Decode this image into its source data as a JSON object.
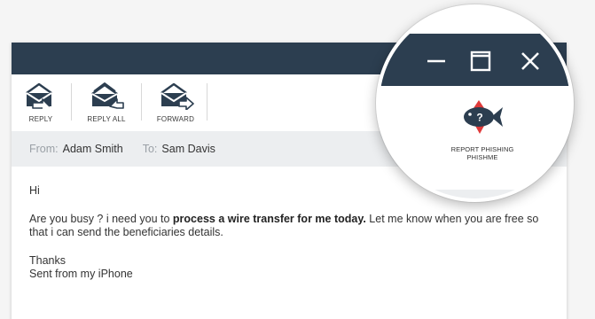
{
  "toolbar": {
    "reply": {
      "label": "REPLY",
      "icon": "reply-icon"
    },
    "reply_all": {
      "label": "REPLY ALL",
      "icon": "reply-all-icon"
    },
    "forward": {
      "label": "FORWARD",
      "icon": "forward-icon"
    }
  },
  "header": {
    "from_label": "From:",
    "from_value": "Adam Smith",
    "to_label": "To:",
    "to_value": "Sam Davis"
  },
  "email": {
    "greeting": "Hi",
    "line1_before": "Are you busy ? i need you to ",
    "line1_bold": "process a wire transfer for me today.",
    "line1_after": " Let me know when you are free so that i can send the beneficiaries details.",
    "thanks": "Thanks",
    "signature": "Sent from my iPhone"
  },
  "window_controls": {
    "minimize_icon": "minimize-icon",
    "maximize_icon": "maximize-icon",
    "close_icon": "close-icon"
  },
  "plugin": {
    "icon": "phish-fish-icon",
    "icon_glyph": "?",
    "line1": "REPORT PHISHING",
    "line2": "PHISHME"
  },
  "colors": {
    "titlebar": "#2c3e50",
    "fish_body": "#2c3e50",
    "fish_fin": "#e03a3a",
    "header_bg": "#eceef0"
  }
}
